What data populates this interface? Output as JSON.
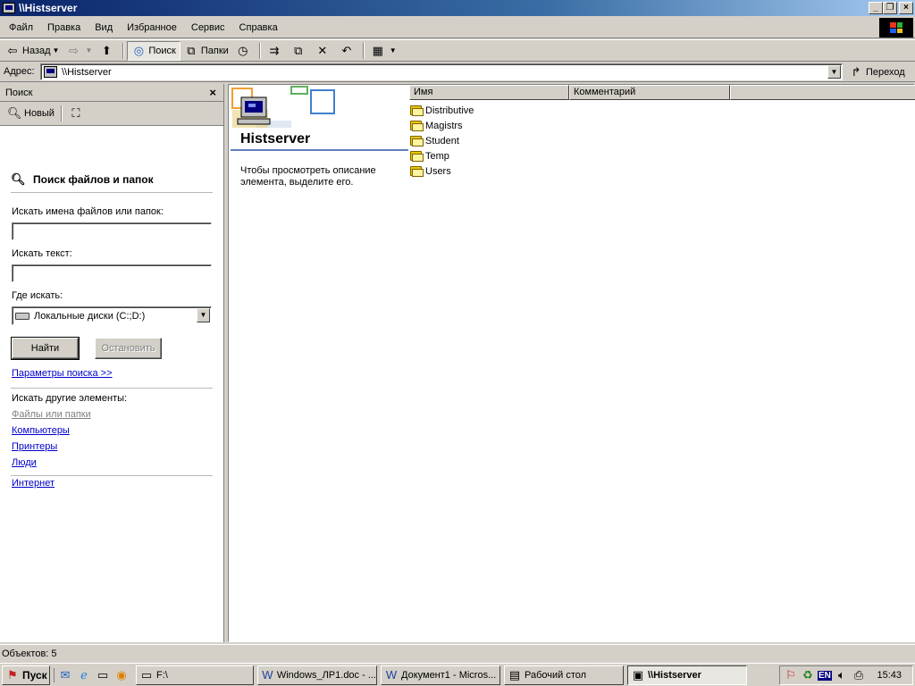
{
  "window": {
    "title": "\\\\Histserver"
  },
  "menu": [
    "Файл",
    "Правка",
    "Вид",
    "Избранное",
    "Сервис",
    "Справка"
  ],
  "toolbar": {
    "back": "Назад",
    "search": "Поиск",
    "folders": "Папки"
  },
  "address": {
    "label": "Адрес:",
    "value": "\\\\Histserver",
    "go": "Переход"
  },
  "search_pane": {
    "header": "Поиск",
    "new": "Новый",
    "title": "Поиск файлов и папок",
    "names_label": "Искать имена файлов или папок:",
    "names_value": "",
    "text_label": "Искать текст:",
    "text_value": "",
    "where_label": "Где искать:",
    "where_value": "Локальные диски (C:;D:)",
    "find": "Найти",
    "stop": "Остановить",
    "options": "Параметры поиска >>",
    "other_label": "Искать другие элементы:",
    "files_folders": "Файлы или папки",
    "computers": "Компьютеры",
    "printers": "Принтеры",
    "people": "Люди",
    "internet": "Интернет"
  },
  "main": {
    "server_name": "Histserver",
    "description": "Чтобы просмотреть описание элемента, выделите его.",
    "columns": [
      "Имя",
      "Комментарий"
    ],
    "items": [
      "Distributive",
      "Magistrs",
      "Student",
      "Temp",
      "Users"
    ]
  },
  "status": {
    "objects": "Объектов: 5"
  },
  "taskbar": {
    "start": "Пуск",
    "tasks": [
      "F:\\",
      "Windows_ЛР1.doc - ...",
      "Документ1 - Micros...",
      "Рабочий стол",
      "\\\\Histserver"
    ],
    "lang": "EN",
    "clock": "15:43"
  }
}
